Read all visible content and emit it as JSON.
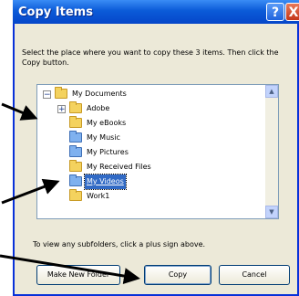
{
  "window": {
    "title": "Copy Items",
    "help_label": "?",
    "close_label": "X"
  },
  "instruction": "Select the place where you want to copy these 3 items. Then click the Copy button.",
  "tree": {
    "items": [
      {
        "label": "My Documents",
        "icon": "my-documents-icon",
        "expander": "−"
      },
      {
        "label": "Adobe",
        "icon": "folder-icon",
        "expander": "+"
      },
      {
        "label": "My eBooks",
        "icon": "folder-icon"
      },
      {
        "label": "My Music",
        "icon": "music-folder-icon"
      },
      {
        "label": "My Pictures",
        "icon": "pictures-folder-icon"
      },
      {
        "label": "My Received Files",
        "icon": "folder-icon"
      },
      {
        "label": "My Videos",
        "icon": "videos-folder-icon",
        "selected": true
      },
      {
        "label": "Work1",
        "icon": "folder-icon"
      }
    ],
    "scroll_up": "▲",
    "scroll_down": "▼"
  },
  "hint": "To view any subfolders, click a plus sign above.",
  "buttons": {
    "make_new_folder": "Make New Folder",
    "copy": "Copy",
    "cancel": "Cancel"
  },
  "colors": {
    "titlebar": "#0b5bd8",
    "selection": "#316ac5",
    "dialog_bg": "#ece9d8"
  }
}
